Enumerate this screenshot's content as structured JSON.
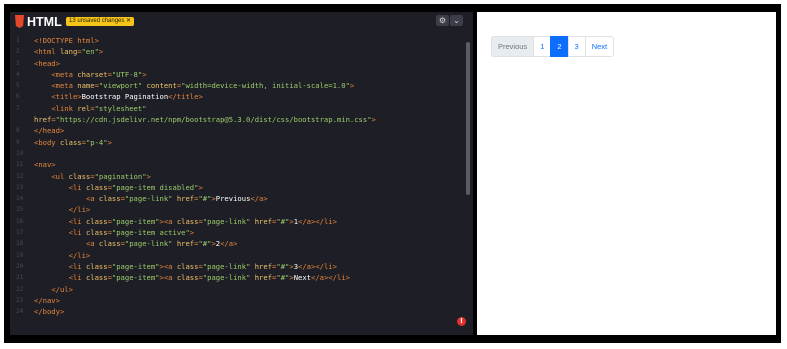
{
  "editor": {
    "language": "HTML",
    "unsaved_badge": "13 unsaved changes ✕",
    "settings_icon": "gear-icon",
    "collapse_icon": "chevron-down-icon",
    "error_icon": "error-icon",
    "error_glyph": "!",
    "lines": [
      {
        "n": "1",
        "parts": [
          {
            "c": "tag",
            "t": "<!DOCTYPE html>"
          }
        ]
      },
      {
        "n": "2",
        "parts": [
          {
            "c": "tag",
            "t": "<html "
          },
          {
            "c": "attr",
            "t": "lang"
          },
          {
            "c": "tag",
            "t": "="
          },
          {
            "c": "val",
            "t": "\"en\""
          },
          {
            "c": "tag",
            "t": ">"
          }
        ]
      },
      {
        "n": "3",
        "parts": [
          {
            "c": "tag",
            "t": "<head>"
          }
        ]
      },
      {
        "n": "4",
        "parts": [
          {
            "c": "plain",
            "t": "    "
          },
          {
            "c": "tag",
            "t": "<meta "
          },
          {
            "c": "attr",
            "t": "charset"
          },
          {
            "c": "tag",
            "t": "="
          },
          {
            "c": "val",
            "t": "\"UTF-8\""
          },
          {
            "c": "tag",
            "t": ">"
          }
        ]
      },
      {
        "n": "5",
        "parts": [
          {
            "c": "plain",
            "t": "    "
          },
          {
            "c": "tag",
            "t": "<meta "
          },
          {
            "c": "attr",
            "t": "name"
          },
          {
            "c": "tag",
            "t": "="
          },
          {
            "c": "val",
            "t": "\"viewport\""
          },
          {
            "c": "tag",
            "t": " "
          },
          {
            "c": "attr",
            "t": "content"
          },
          {
            "c": "tag",
            "t": "="
          },
          {
            "c": "val",
            "t": "\"width=device-width, initial-scale=1.0\""
          },
          {
            "c": "tag",
            "t": ">"
          }
        ]
      },
      {
        "n": "6",
        "parts": [
          {
            "c": "plain",
            "t": "    "
          },
          {
            "c": "tag",
            "t": "<title>"
          },
          {
            "c": "plain",
            "t": "Bootstrap Pagination"
          },
          {
            "c": "tag",
            "t": "</title>"
          }
        ]
      },
      {
        "n": "7",
        "parts": [
          {
            "c": "plain",
            "t": "    "
          },
          {
            "c": "tag",
            "t": "<link "
          },
          {
            "c": "attr",
            "t": "rel"
          },
          {
            "c": "tag",
            "t": "="
          },
          {
            "c": "val",
            "t": "\"stylesheet\""
          }
        ]
      },
      {
        "n": "",
        "parts": [
          {
            "c": "attr",
            "t": "href"
          },
          {
            "c": "tag",
            "t": "="
          },
          {
            "c": "val",
            "t": "\"https://cdn.jsdelivr.net/npm/bootstrap@5.3.0/dist/css/bootstrap.min.css\""
          },
          {
            "c": "tag",
            "t": ">"
          }
        ]
      },
      {
        "n": "8",
        "parts": [
          {
            "c": "tag",
            "t": "</head>"
          }
        ]
      },
      {
        "n": "9",
        "parts": [
          {
            "c": "tag",
            "t": "<body "
          },
          {
            "c": "attr",
            "t": "class"
          },
          {
            "c": "tag",
            "t": "="
          },
          {
            "c": "val",
            "t": "\"p-4\""
          },
          {
            "c": "tag",
            "t": ">"
          }
        ]
      },
      {
        "n": "10",
        "parts": []
      },
      {
        "n": "11",
        "parts": [
          {
            "c": "tag",
            "t": "<nav>"
          }
        ]
      },
      {
        "n": "12",
        "parts": [
          {
            "c": "plain",
            "t": "    "
          },
          {
            "c": "tag",
            "t": "<ul "
          },
          {
            "c": "attr",
            "t": "class"
          },
          {
            "c": "tag",
            "t": "="
          },
          {
            "c": "val",
            "t": "\"pagination\""
          },
          {
            "c": "tag",
            "t": ">"
          }
        ]
      },
      {
        "n": "13",
        "parts": [
          {
            "c": "plain",
            "t": "        "
          },
          {
            "c": "tag",
            "t": "<li "
          },
          {
            "c": "attr",
            "t": "class"
          },
          {
            "c": "tag",
            "t": "="
          },
          {
            "c": "val",
            "t": "\"page-item disabled\""
          },
          {
            "c": "tag",
            "t": ">"
          }
        ]
      },
      {
        "n": "14",
        "parts": [
          {
            "c": "plain",
            "t": "            "
          },
          {
            "c": "tag",
            "t": "<a "
          },
          {
            "c": "attr",
            "t": "class"
          },
          {
            "c": "tag",
            "t": "="
          },
          {
            "c": "val",
            "t": "\"page-link\""
          },
          {
            "c": "tag",
            "t": " "
          },
          {
            "c": "attr",
            "t": "href"
          },
          {
            "c": "tag",
            "t": "="
          },
          {
            "c": "val",
            "t": "\"#\""
          },
          {
            "c": "tag",
            "t": ">"
          },
          {
            "c": "plain",
            "t": "Previous"
          },
          {
            "c": "tag",
            "t": "</a>"
          }
        ]
      },
      {
        "n": "15",
        "parts": [
          {
            "c": "plain",
            "t": "        "
          },
          {
            "c": "tag",
            "t": "</li>"
          }
        ]
      },
      {
        "n": "16",
        "parts": [
          {
            "c": "plain",
            "t": "        "
          },
          {
            "c": "tag",
            "t": "<li "
          },
          {
            "c": "attr",
            "t": "class"
          },
          {
            "c": "tag",
            "t": "="
          },
          {
            "c": "val",
            "t": "\"page-item\""
          },
          {
            "c": "tag",
            "t": "><a "
          },
          {
            "c": "attr",
            "t": "class"
          },
          {
            "c": "tag",
            "t": "="
          },
          {
            "c": "val",
            "t": "\"page-link\""
          },
          {
            "c": "tag",
            "t": " "
          },
          {
            "c": "attr",
            "t": "href"
          },
          {
            "c": "tag",
            "t": "="
          },
          {
            "c": "val",
            "t": "\"#\""
          },
          {
            "c": "tag",
            "t": ">"
          },
          {
            "c": "plain",
            "t": "1"
          },
          {
            "c": "tag",
            "t": "</a></li>"
          }
        ]
      },
      {
        "n": "17",
        "parts": [
          {
            "c": "plain",
            "t": "        "
          },
          {
            "c": "tag",
            "t": "<li "
          },
          {
            "c": "attr",
            "t": "class"
          },
          {
            "c": "tag",
            "t": "="
          },
          {
            "c": "val",
            "t": "\"page-item active\""
          },
          {
            "c": "tag",
            "t": ">"
          }
        ]
      },
      {
        "n": "18",
        "parts": [
          {
            "c": "plain",
            "t": "            "
          },
          {
            "c": "tag",
            "t": "<a "
          },
          {
            "c": "attr",
            "t": "class"
          },
          {
            "c": "tag",
            "t": "="
          },
          {
            "c": "val",
            "t": "\"page-link\""
          },
          {
            "c": "tag",
            "t": " "
          },
          {
            "c": "attr",
            "t": "href"
          },
          {
            "c": "tag",
            "t": "="
          },
          {
            "c": "val",
            "t": "\"#\""
          },
          {
            "c": "tag",
            "t": ">"
          },
          {
            "c": "plain",
            "t": "2"
          },
          {
            "c": "tag",
            "t": "</a>"
          }
        ]
      },
      {
        "n": "19",
        "parts": [
          {
            "c": "plain",
            "t": "        "
          },
          {
            "c": "tag",
            "t": "</li>"
          }
        ]
      },
      {
        "n": "20",
        "parts": [
          {
            "c": "plain",
            "t": "        "
          },
          {
            "c": "tag",
            "t": "<li "
          },
          {
            "c": "attr",
            "t": "class"
          },
          {
            "c": "tag",
            "t": "="
          },
          {
            "c": "val",
            "t": "\"page-item\""
          },
          {
            "c": "tag",
            "t": "><a "
          },
          {
            "c": "attr",
            "t": "class"
          },
          {
            "c": "tag",
            "t": "="
          },
          {
            "c": "val",
            "t": "\"page-link\""
          },
          {
            "c": "tag",
            "t": " "
          },
          {
            "c": "attr",
            "t": "href"
          },
          {
            "c": "tag",
            "t": "="
          },
          {
            "c": "val",
            "t": "\"#\""
          },
          {
            "c": "tag",
            "t": ">"
          },
          {
            "c": "plain",
            "t": "3"
          },
          {
            "c": "tag",
            "t": "</a></li>"
          }
        ]
      },
      {
        "n": "21",
        "parts": [
          {
            "c": "plain",
            "t": "        "
          },
          {
            "c": "tag",
            "t": "<li "
          },
          {
            "c": "attr",
            "t": "class"
          },
          {
            "c": "tag",
            "t": "="
          },
          {
            "c": "val",
            "t": "\"page-item\""
          },
          {
            "c": "tag",
            "t": "><a "
          },
          {
            "c": "attr",
            "t": "class"
          },
          {
            "c": "tag",
            "t": "="
          },
          {
            "c": "val",
            "t": "\"page-link\""
          },
          {
            "c": "tag",
            "t": " "
          },
          {
            "c": "attr",
            "t": "href"
          },
          {
            "c": "tag",
            "t": "="
          },
          {
            "c": "val",
            "t": "\"#\""
          },
          {
            "c": "tag",
            "t": ">"
          },
          {
            "c": "plain",
            "t": "Next"
          },
          {
            "c": "tag",
            "t": "</a></li>"
          }
        ]
      },
      {
        "n": "22",
        "parts": [
          {
            "c": "plain",
            "t": "    "
          },
          {
            "c": "tag",
            "t": "</ul>"
          }
        ]
      },
      {
        "n": "23",
        "parts": [
          {
            "c": "tag",
            "t": "</nav>"
          }
        ]
      },
      {
        "n": "24",
        "parts": [
          {
            "c": "tag",
            "t": "</body>"
          }
        ]
      }
    ]
  },
  "preview": {
    "pagination": [
      {
        "label": "Previous",
        "state": "disabled"
      },
      {
        "label": "1",
        "state": "normal"
      },
      {
        "label": "2",
        "state": "active"
      },
      {
        "label": "3",
        "state": "normal"
      },
      {
        "label": "Next",
        "state": "normal"
      }
    ]
  },
  "colors": {
    "editor_bg": "#1e1f26",
    "tag": "#e5863a",
    "attr": "#f0c36a",
    "value": "#9ccc6a",
    "badge": "#f5c518",
    "active_page": "#0d6efd",
    "link": "#0d6efd",
    "error": "#e03131"
  }
}
